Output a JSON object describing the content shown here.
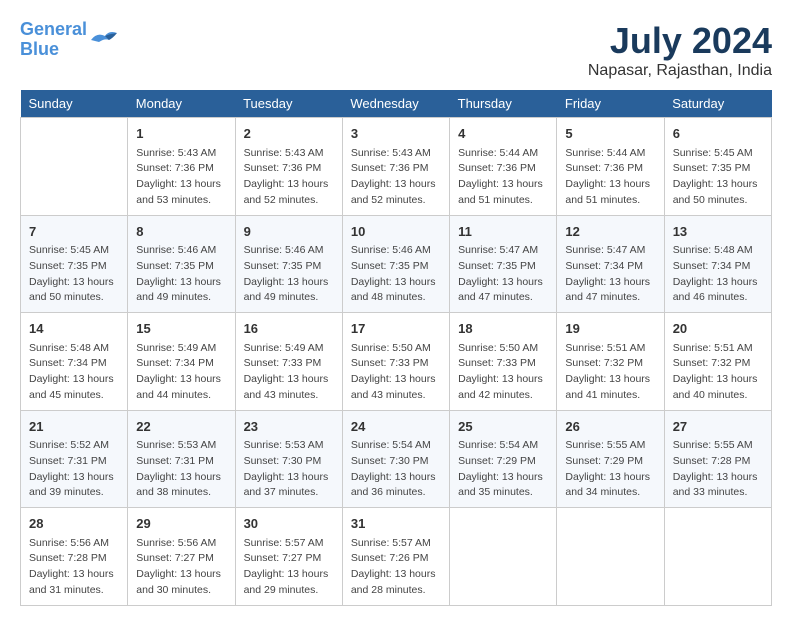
{
  "header": {
    "logo_line1": "General",
    "logo_line2": "Blue",
    "title": "July 2024",
    "subtitle": "Napasar, Rajasthan, India"
  },
  "days_of_week": [
    "Sunday",
    "Monday",
    "Tuesday",
    "Wednesday",
    "Thursday",
    "Friday",
    "Saturday"
  ],
  "weeks": [
    [
      {
        "day": "",
        "content": ""
      },
      {
        "day": "1",
        "content": "Sunrise: 5:43 AM\nSunset: 7:36 PM\nDaylight: 13 hours\nand 53 minutes."
      },
      {
        "day": "2",
        "content": "Sunrise: 5:43 AM\nSunset: 7:36 PM\nDaylight: 13 hours\nand 52 minutes."
      },
      {
        "day": "3",
        "content": "Sunrise: 5:43 AM\nSunset: 7:36 PM\nDaylight: 13 hours\nand 52 minutes."
      },
      {
        "day": "4",
        "content": "Sunrise: 5:44 AM\nSunset: 7:36 PM\nDaylight: 13 hours\nand 51 minutes."
      },
      {
        "day": "5",
        "content": "Sunrise: 5:44 AM\nSunset: 7:36 PM\nDaylight: 13 hours\nand 51 minutes."
      },
      {
        "day": "6",
        "content": "Sunrise: 5:45 AM\nSunset: 7:35 PM\nDaylight: 13 hours\nand 50 minutes."
      }
    ],
    [
      {
        "day": "7",
        "content": "Sunrise: 5:45 AM\nSunset: 7:35 PM\nDaylight: 13 hours\nand 50 minutes."
      },
      {
        "day": "8",
        "content": "Sunrise: 5:46 AM\nSunset: 7:35 PM\nDaylight: 13 hours\nand 49 minutes."
      },
      {
        "day": "9",
        "content": "Sunrise: 5:46 AM\nSunset: 7:35 PM\nDaylight: 13 hours\nand 49 minutes."
      },
      {
        "day": "10",
        "content": "Sunrise: 5:46 AM\nSunset: 7:35 PM\nDaylight: 13 hours\nand 48 minutes."
      },
      {
        "day": "11",
        "content": "Sunrise: 5:47 AM\nSunset: 7:35 PM\nDaylight: 13 hours\nand 47 minutes."
      },
      {
        "day": "12",
        "content": "Sunrise: 5:47 AM\nSunset: 7:34 PM\nDaylight: 13 hours\nand 47 minutes."
      },
      {
        "day": "13",
        "content": "Sunrise: 5:48 AM\nSunset: 7:34 PM\nDaylight: 13 hours\nand 46 minutes."
      }
    ],
    [
      {
        "day": "14",
        "content": "Sunrise: 5:48 AM\nSunset: 7:34 PM\nDaylight: 13 hours\nand 45 minutes."
      },
      {
        "day": "15",
        "content": "Sunrise: 5:49 AM\nSunset: 7:34 PM\nDaylight: 13 hours\nand 44 minutes."
      },
      {
        "day": "16",
        "content": "Sunrise: 5:49 AM\nSunset: 7:33 PM\nDaylight: 13 hours\nand 43 minutes."
      },
      {
        "day": "17",
        "content": "Sunrise: 5:50 AM\nSunset: 7:33 PM\nDaylight: 13 hours\nand 43 minutes."
      },
      {
        "day": "18",
        "content": "Sunrise: 5:50 AM\nSunset: 7:33 PM\nDaylight: 13 hours\nand 42 minutes."
      },
      {
        "day": "19",
        "content": "Sunrise: 5:51 AM\nSunset: 7:32 PM\nDaylight: 13 hours\nand 41 minutes."
      },
      {
        "day": "20",
        "content": "Sunrise: 5:51 AM\nSunset: 7:32 PM\nDaylight: 13 hours\nand 40 minutes."
      }
    ],
    [
      {
        "day": "21",
        "content": "Sunrise: 5:52 AM\nSunset: 7:31 PM\nDaylight: 13 hours\nand 39 minutes."
      },
      {
        "day": "22",
        "content": "Sunrise: 5:53 AM\nSunset: 7:31 PM\nDaylight: 13 hours\nand 38 minutes."
      },
      {
        "day": "23",
        "content": "Sunrise: 5:53 AM\nSunset: 7:30 PM\nDaylight: 13 hours\nand 37 minutes."
      },
      {
        "day": "24",
        "content": "Sunrise: 5:54 AM\nSunset: 7:30 PM\nDaylight: 13 hours\nand 36 minutes."
      },
      {
        "day": "25",
        "content": "Sunrise: 5:54 AM\nSunset: 7:29 PM\nDaylight: 13 hours\nand 35 minutes."
      },
      {
        "day": "26",
        "content": "Sunrise: 5:55 AM\nSunset: 7:29 PM\nDaylight: 13 hours\nand 34 minutes."
      },
      {
        "day": "27",
        "content": "Sunrise: 5:55 AM\nSunset: 7:28 PM\nDaylight: 13 hours\nand 33 minutes."
      }
    ],
    [
      {
        "day": "28",
        "content": "Sunrise: 5:56 AM\nSunset: 7:28 PM\nDaylight: 13 hours\nand 31 minutes."
      },
      {
        "day": "29",
        "content": "Sunrise: 5:56 AM\nSunset: 7:27 PM\nDaylight: 13 hours\nand 30 minutes."
      },
      {
        "day": "30",
        "content": "Sunrise: 5:57 AM\nSunset: 7:27 PM\nDaylight: 13 hours\nand 29 minutes."
      },
      {
        "day": "31",
        "content": "Sunrise: 5:57 AM\nSunset: 7:26 PM\nDaylight: 13 hours\nand 28 minutes."
      },
      {
        "day": "",
        "content": ""
      },
      {
        "day": "",
        "content": ""
      },
      {
        "day": "",
        "content": ""
      }
    ]
  ]
}
